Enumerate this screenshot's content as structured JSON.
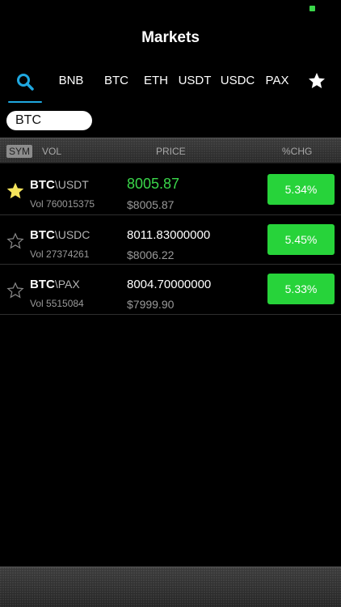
{
  "header": {
    "title": "Markets"
  },
  "tabs": [
    {
      "label": "BNB"
    },
    {
      "label": "BTC"
    },
    {
      "label": "ETH"
    },
    {
      "label": "USDT"
    },
    {
      "label": "USDC"
    },
    {
      "label": "PAX"
    }
  ],
  "search": {
    "value": "BTC"
  },
  "columns": {
    "sym": "SYM",
    "vol": "VOL",
    "price": "PRICE",
    "chg": "%CHG"
  },
  "colors": {
    "accent": "#1fa8e0",
    "up": "#27d33a",
    "status": "#3ad64a",
    "star_active": "#f5e45c"
  },
  "rows": [
    {
      "base": "BTC",
      "quote": "\\USDT",
      "vol": "Vol 760015375",
      "price": "8005.87",
      "usd": "$8005.87",
      "chg": "5.34%",
      "favorite": true
    },
    {
      "base": "BTC",
      "quote": "\\USDC",
      "vol": "Vol 27374261",
      "price": "8011.83000000",
      "usd": "$8006.22",
      "chg": "5.45%",
      "favorite": false
    },
    {
      "base": "BTC",
      "quote": "\\PAX",
      "vol": "Vol 5515084",
      "price": "8004.70000000",
      "usd": "$7999.90",
      "chg": "5.33%",
      "favorite": false
    }
  ]
}
